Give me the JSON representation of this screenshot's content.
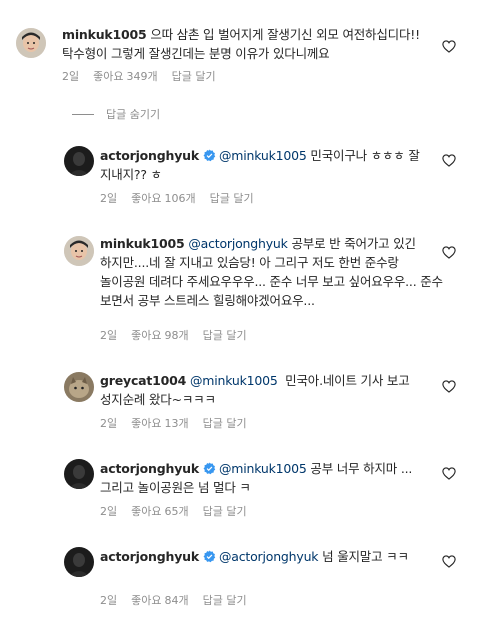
{
  "colors": {
    "mention": "#00376b",
    "verified": "#3897f0",
    "meta": "#8e8e8e",
    "text": "#262626"
  },
  "icons": {
    "like": "heart-outline-icon",
    "verified": "verified-badge-icon"
  },
  "hide_replies_label": "답글 숨기기",
  "like_label": "좋아요",
  "reply_label": "답글 달기",
  "comments": [
    {
      "username": "minkuk1005",
      "verified": false,
      "mention": "",
      "text": "으따 삼촌 입 벌어지게 잘생기신 외모 여전하십디다!! 탁수형이 그렇게 잘생긴데는 분명 이유가 있다니께요",
      "time": "2일",
      "likes": "349개",
      "avatar": "child-photo"
    },
    {
      "username": "actorjonghyuk",
      "verified": true,
      "mention": "@minkuk1005",
      "text": " 민국이구나 ㅎㅎㅎ 잘 지내지?? ㅎ",
      "time": "2일",
      "likes": "106개",
      "avatar": "dark-portrait"
    },
    {
      "username": "minkuk1005",
      "verified": false,
      "mention": "@actorjonghyuk",
      "text": " 공부로 반 죽어가고 있긴 하지만....네 잘 지내고 있슴당! 아 그리구 저도 한번 준수랑 놀이공원 데려다 주세요우우우... 준수 너무 보고 싶어요우우... 준수 보면서 공부 스트레스 힐링해야겠어요우...",
      "time": "2일",
      "likes": "98개",
      "avatar": "child-photo"
    },
    {
      "username": "greycat1004",
      "verified": false,
      "mention": "@minkuk1005",
      "text": "  민국아.네이트 기사 보고 성지순례 왔다~ㅋㅋㅋ",
      "time": "2일",
      "likes": "13개",
      "avatar": "cat-photo"
    },
    {
      "username": "actorjonghyuk",
      "verified": true,
      "mention": "@minkuk1005",
      "text": " 공부 너무 하지마 ...그리고 놀이공원은 넘 멀다 ㅋ",
      "time": "2일",
      "likes": "65개",
      "avatar": "dark-portrait"
    },
    {
      "username": "actorjonghyuk",
      "verified": true,
      "mention": "@actorjonghyuk",
      "text": " 넘 울지말고 ㅋㅋ",
      "time": "2일",
      "likes": "84개",
      "avatar": "dark-portrait"
    }
  ]
}
